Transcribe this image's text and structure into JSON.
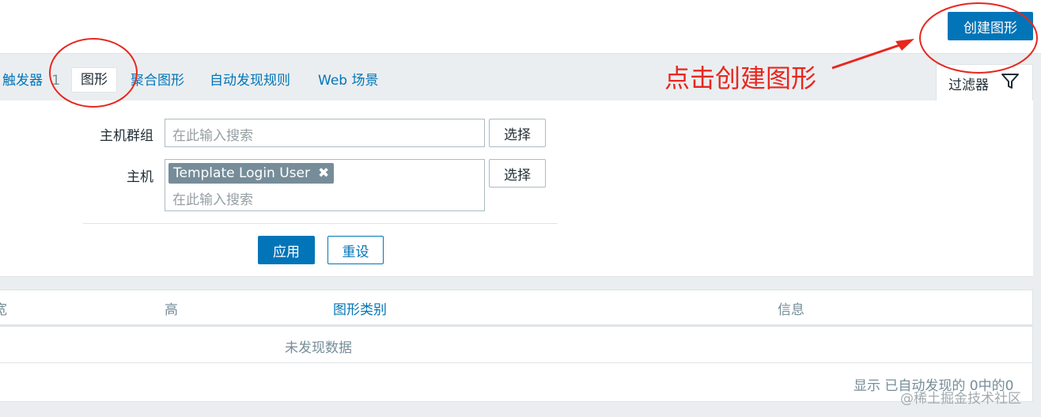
{
  "header": {
    "create_button": "创建图形"
  },
  "tabs": [
    {
      "label": "触发器",
      "count": "1"
    },
    {
      "label": "图形"
    },
    {
      "label": "聚合图形"
    },
    {
      "label": "自动发现规则"
    },
    {
      "label": "Web 场景"
    }
  ],
  "filter_tab": {
    "label": "过滤器",
    "icon": "funnel-icon"
  },
  "annotation": {
    "text": "点击创建图形",
    "color": "#e8271f"
  },
  "filter": {
    "host_group": {
      "label": "主机群组",
      "placeholder": "在此输入搜索",
      "select_label": "选择"
    },
    "host": {
      "label": "主机",
      "tag": "Template Login User",
      "tag_remove_icon": "close-icon",
      "placeholder": "在此输入搜索",
      "select_label": "选择"
    },
    "apply_label": "应用",
    "reset_label": "重设"
  },
  "table": {
    "columns": [
      "宽",
      "高",
      "图形类别",
      "信息"
    ],
    "empty_message": "未发现数据",
    "footer": "显示 已自动发现的 0中的0"
  },
  "watermark": "@稀土掘金技术社区",
  "colors": {
    "accent": "#0275b8",
    "background": "#ebeef0",
    "annotation": "#e8271f"
  }
}
